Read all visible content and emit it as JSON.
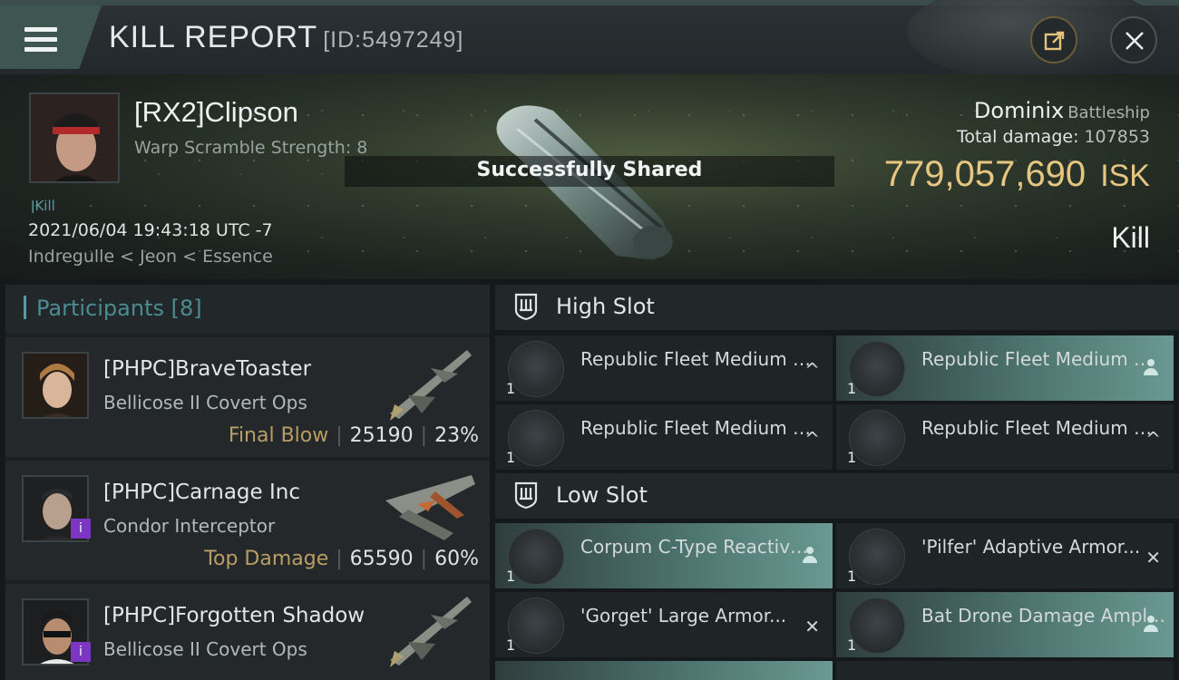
{
  "header": {
    "title": "KILL REPORT",
    "report_id": "[ID:5497249]",
    "menu_icon": "hamburger-menu-icon",
    "share_icon": "share-export-icon",
    "close_icon": "close-icon"
  },
  "victim": {
    "name": "[RX2]Clipson",
    "warp_scramble": "Warp Scramble Strength: 8",
    "kill_tag": "Kill",
    "timestamp": "2021/06/04 19:43:18 UTC -7",
    "location": "Indregulle < Jeon < Essence",
    "ship_name": "Dominix",
    "ship_class": "Battleship",
    "total_damage_label": "Total damage:",
    "total_damage": "107853",
    "isk_value": "779,057,690",
    "isk_unit": "ISK",
    "result": "Kill"
  },
  "toast": {
    "text": "Successfully Shared"
  },
  "participants": {
    "header": "Participants [8]",
    "rows": [
      {
        "name": "[PHPC]BraveToaster",
        "ship": "Bellicose II Covert Ops",
        "role": "Final Blow",
        "damage": "25190",
        "percent": "23%"
      },
      {
        "name": "[PHPC]Carnage Inc",
        "ship": "Condor Interceptor",
        "role": "Top Damage",
        "damage": "65590",
        "percent": "60%"
      },
      {
        "name": "[PHPC]Forgotten Shadow",
        "ship": "Bellicose II Covert Ops",
        "role": "",
        "damage": "",
        "percent": ""
      }
    ]
  },
  "fitting": {
    "high_slot_title": "High Slot",
    "low_slot_title": "Low Slot",
    "high_slot": [
      {
        "name": "Republic Fleet Medium Rapi...",
        "qty": "1",
        "mark": "^"
      },
      {
        "name": "Republic Fleet Medium Rapi...",
        "qty": "1",
        "mark": "pilot"
      },
      {
        "name": "Republic Fleet Medium Rapi...",
        "qty": "1",
        "mark": "^"
      },
      {
        "name": "Republic Fleet Medium Rapi...",
        "qty": "1",
        "mark": "^"
      }
    ],
    "low_slot": [
      {
        "name": "Corpum C-Type Reactive...",
        "qty": "1",
        "mark": "pilot"
      },
      {
        "name": "'Pilfer' Adaptive Armor...",
        "qty": "1",
        "mark": "✕"
      },
      {
        "name": "'Gorget' Large Armor...",
        "qty": "1",
        "mark": "✕"
      },
      {
        "name": "Bat Drone Damage Amplifier",
        "qty": "1",
        "mark": "pilot"
      }
    ]
  },
  "colors": {
    "accent_teal": "#4f9fa3",
    "isk_gold": "#e6c680",
    "role_gold": "#b89e62",
    "highlight": "#6a9892"
  }
}
